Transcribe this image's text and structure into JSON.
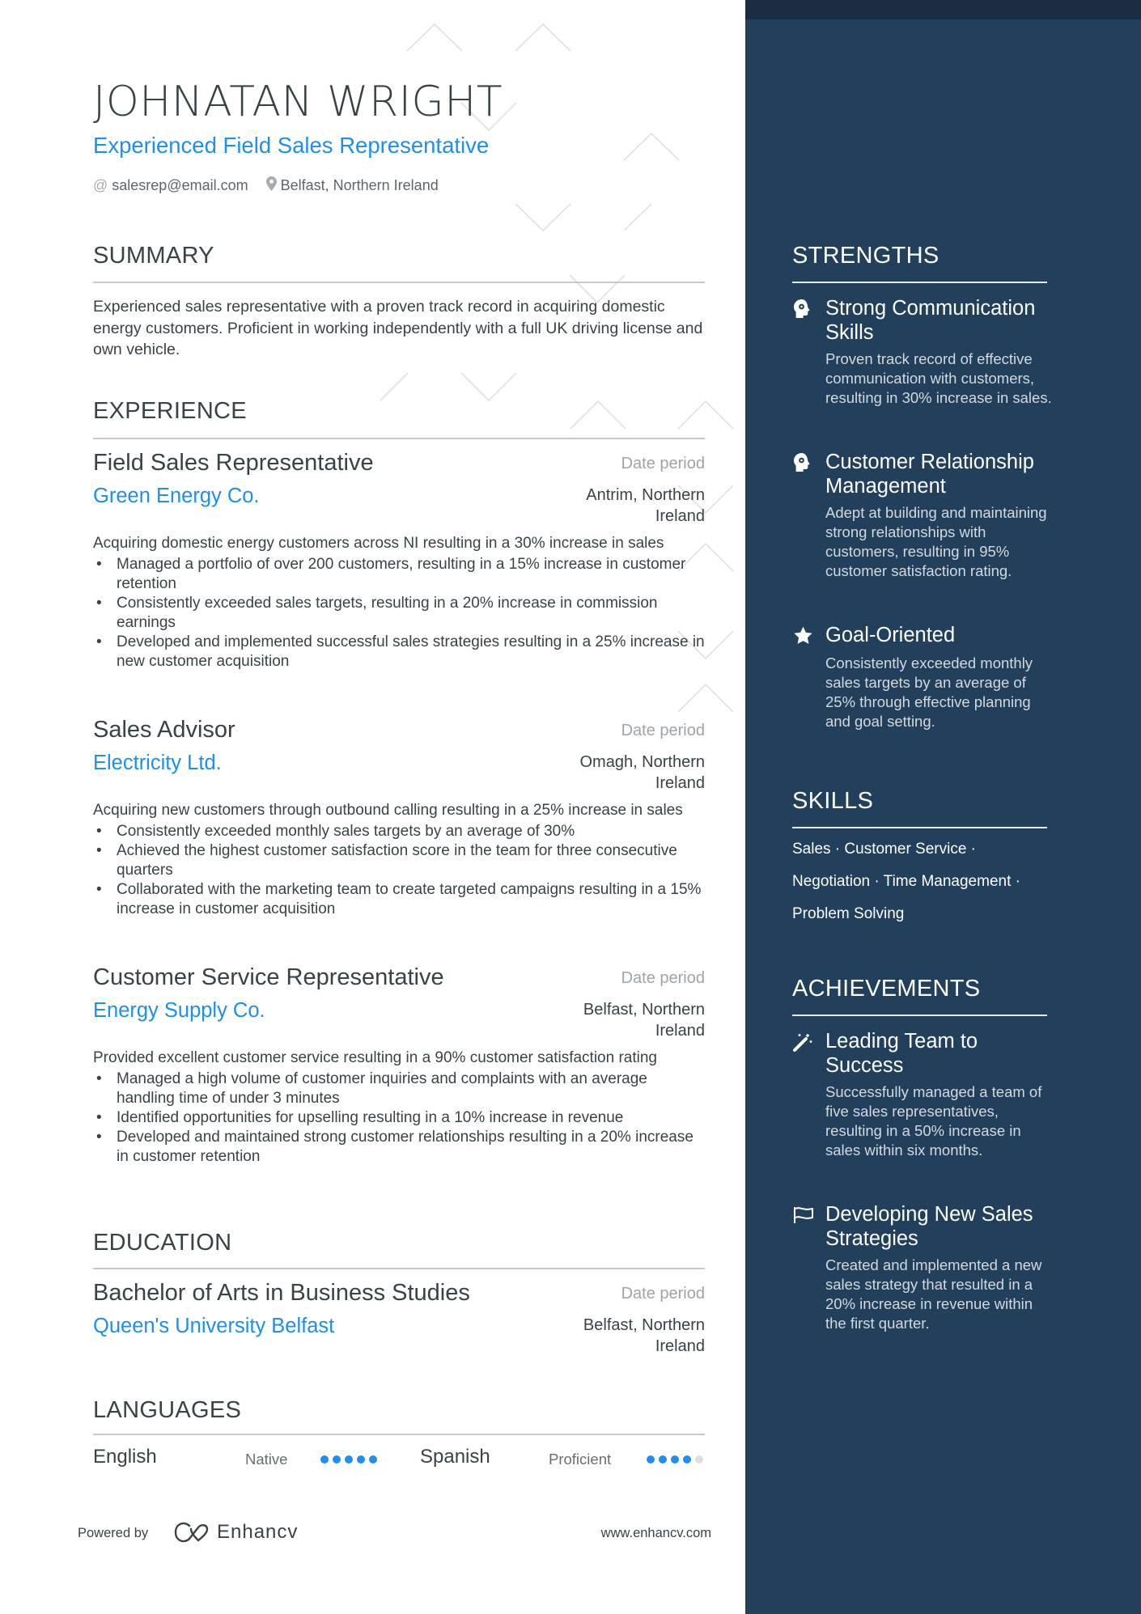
{
  "header": {
    "name": "JOHNATAN WRIGHT",
    "title": "Experienced Field Sales Representative",
    "contact": [
      {
        "icon": "at-icon",
        "text": "salesrep@email.com"
      },
      {
        "icon": "location-pin-icon",
        "text": "Belfast, Northern Ireland"
      }
    ]
  },
  "summary": {
    "heading": "SUMMARY",
    "text": "Experienced sales representative with a proven track record in acquiring domestic energy customers. Proficient in working independently with a full UK driving license and own vehicle."
  },
  "experience": {
    "heading": "EXPERIENCE",
    "entries": [
      {
        "role": "Field Sales Representative",
        "date": "Date period",
        "company": "Green Energy Co.",
        "location": "Antrim, Northern Ireland",
        "description": "Acquiring domestic energy customers across NI resulting in a 30% increase in sales",
        "bullets": [
          "Managed a portfolio of over 200 customers, resulting in a 15% increase in customer retention",
          "Consistently exceeded sales targets, resulting in a 20% increase in commission earnings",
          "Developed and implemented successful sales strategies resulting in a 25% increase in new customer acquisition"
        ]
      },
      {
        "role": "Sales Advisor",
        "date": "Date period",
        "company": "Electricity Ltd.",
        "location": "Omagh, Northern Ireland",
        "description": "Acquiring new customers through outbound calling resulting in a 25% increase in sales",
        "bullets": [
          "Consistently exceeded monthly sales targets by an average of 30%",
          "Achieved the highest customer satisfaction score in the team for three consecutive quarters",
          "Collaborated with the marketing team to create targeted campaigns resulting in a 15% increase in customer acquisition"
        ]
      },
      {
        "role": "Customer Service Representative",
        "date": "Date period",
        "company": "Energy Supply Co.",
        "location": "Belfast, Northern Ireland",
        "description": "Provided excellent customer service resulting in a 90% customer satisfaction rating",
        "bullets": [
          "Managed a high volume of customer inquiries and complaints with an average handling time of under 3 minutes",
          "Identified opportunities for upselling resulting in a 10% increase in revenue",
          "Developed and maintained strong customer relationships resulting in a 20% increase in customer retention"
        ]
      }
    ]
  },
  "education": {
    "heading": "EDUCATION",
    "entries": [
      {
        "degree": "Bachelor of Arts in Business Studies",
        "date": "Date period",
        "school": "Queen's University Belfast",
        "location": "Belfast, Northern Ireland"
      }
    ]
  },
  "languages": {
    "heading": "LANGUAGES",
    "items": [
      {
        "name": "English",
        "level": "Native",
        "rating": 5,
        "max": 5
      },
      {
        "name": "Spanish",
        "level": "Proficient",
        "rating": 4,
        "max": 5
      }
    ]
  },
  "footer": {
    "powered_by": "Powered by",
    "brand": "Enhancv",
    "website": "www.enhancv.com"
  },
  "sidebar": {
    "strengths": {
      "heading": "STRENGTHS",
      "items": [
        {
          "icon": "head-brain-icon",
          "title": "Strong Communication Skills",
          "description": "Proven track record of effective communication with customers, resulting in 30% increase in sales."
        },
        {
          "icon": "head-brain-icon",
          "title": "Customer Relationship Management",
          "description": "Adept at building and maintaining strong relationships with customers, resulting in 95% customer satisfaction rating."
        },
        {
          "icon": "star-icon",
          "title": "Goal-Oriented",
          "description": "Consistently exceeded monthly sales targets by an average of 25% through effective planning and goal setting."
        }
      ]
    },
    "skills": {
      "heading": "SKILLS",
      "items": [
        "Sales",
        "Customer Service",
        "Negotiation",
        "Time Management",
        "Problem Solving"
      ],
      "lines": [
        "Sales · Customer Service ·",
        "Negotiation · Time Management ·",
        "Problem Solving"
      ]
    },
    "achievements": {
      "heading": "ACHIEVEMENTS",
      "items": [
        {
          "icon": "magic-wand-icon",
          "title": "Leading Team to Success",
          "description": "Successfully managed a team of five sales representatives, resulting in a 50% increase in sales within six months."
        },
        {
          "icon": "flag-icon",
          "title": "Developing New Sales Strategies",
          "description": "Created and implemented a new sales strategy that resulted in a 20% increase in revenue within the first quarter."
        }
      ]
    }
  },
  "colors": {
    "accent": "#1e8ff0",
    "sidebar_bg": "#223f5b",
    "sidebar_band": "#1a2d43",
    "text": "#384347",
    "muted": "#9ea4a7",
    "rule": "#c6c9cb",
    "dot_off": "#dcdfe0"
  }
}
